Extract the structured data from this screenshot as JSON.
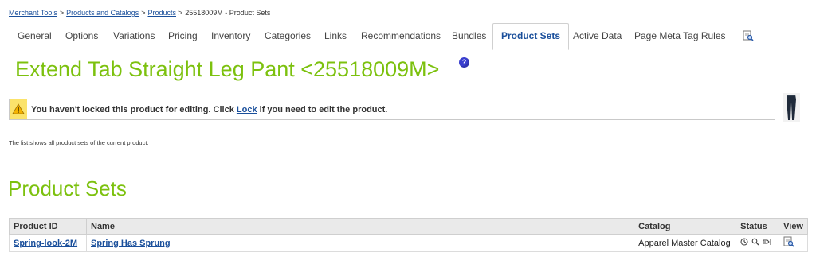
{
  "breadcrumb": {
    "items": [
      "Merchant Tools",
      "Products and Catalogs",
      "Products"
    ],
    "current": "25518009M - Product Sets",
    "separator": ">"
  },
  "tabs": {
    "items": [
      "General",
      "Options",
      "Variations",
      "Pricing",
      "Inventory",
      "Categories",
      "Links",
      "Recommendations",
      "Bundles",
      "Product Sets",
      "Active Data",
      "Page Meta Tag Rules"
    ],
    "active": "Product Sets",
    "preview_icon": "preview-icon"
  },
  "product": {
    "title": "Extend Tab Straight Leg Pant <25518009M>",
    "help_icon": "help-icon",
    "thumbnail_icon": "pant-thumbnail"
  },
  "lock_notice": {
    "before": "You haven't locked this product for editing. Click ",
    "link": "Lock",
    "after": " if you need to edit the product.",
    "icon": "warning-icon"
  },
  "description": "The list shows all product sets of the current product.",
  "section": {
    "title": "Product Sets"
  },
  "table": {
    "columns": [
      "Product ID",
      "Name",
      "Catalog",
      "Status",
      "View"
    ],
    "rows": [
      {
        "product_id": "Spring-look-2M",
        "name": "Spring Has Sprung",
        "catalog": "Apparel Master Catalog",
        "status_icons": [
          "online-icon",
          "searchable-icon",
          "sellable-icon"
        ],
        "view_icon": "view-icon"
      }
    ]
  },
  "colors": {
    "title_green": "#7cc10e",
    "link_blue": "#1a4f9b",
    "warning_yellow": "#fbe36b"
  }
}
